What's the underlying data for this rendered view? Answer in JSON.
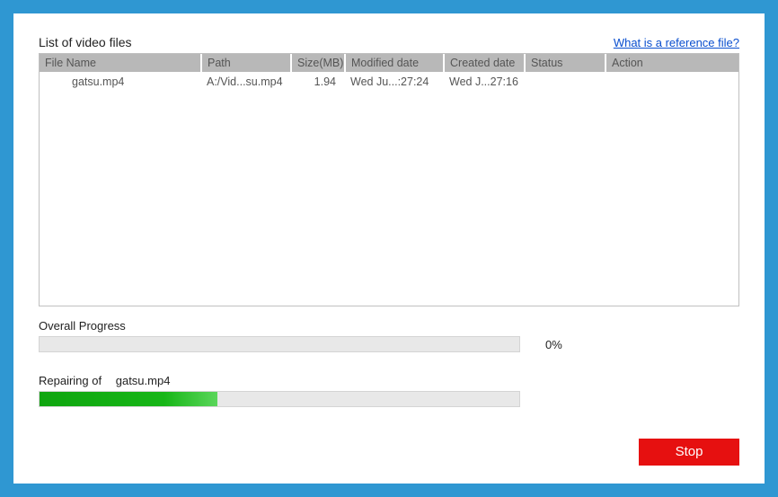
{
  "title": "List of video files",
  "reference_link": "What is a reference file?",
  "columns": {
    "file_name": "File Name",
    "path": "Path",
    "size": "Size(MB)",
    "modified": "Modified date",
    "created": "Created date",
    "status": "Status",
    "action": "Action"
  },
  "rows": [
    {
      "file_name": "gatsu.mp4",
      "path": "A:/Vid...su.mp4",
      "size": "1.94",
      "modified": "Wed Ju...:27:24",
      "created": "Wed J...27:16",
      "status": "",
      "action": ""
    }
  ],
  "overall": {
    "label": "Overall Progress",
    "percent_text": "0%",
    "percent_value": 0
  },
  "repair": {
    "prefix": "Repairing of",
    "file": "gatsu.mp4",
    "percent_value": 37
  },
  "stop_label": "Stop"
}
